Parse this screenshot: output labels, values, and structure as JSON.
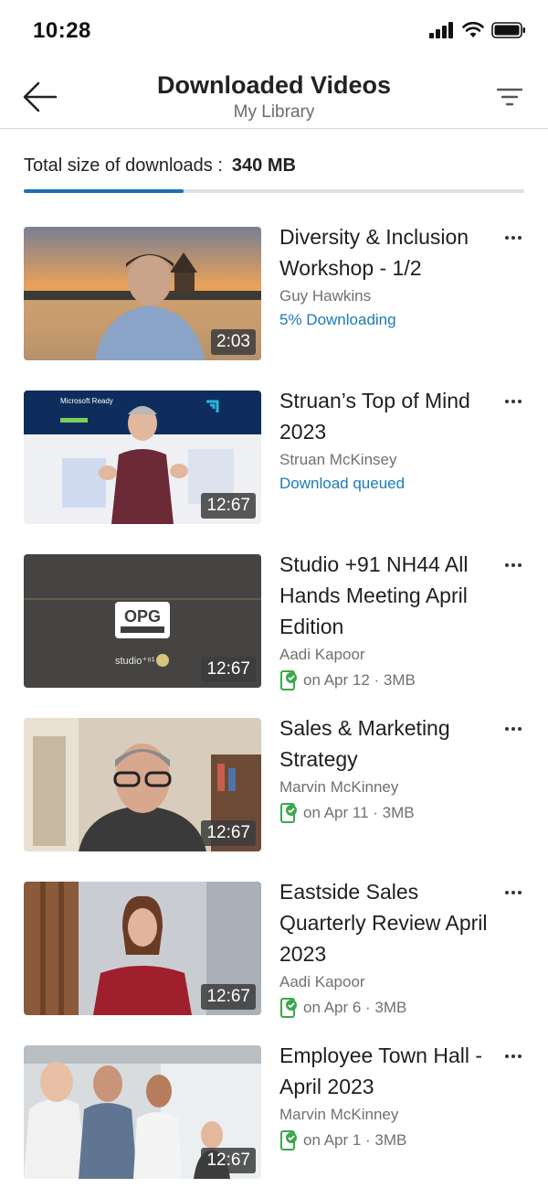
{
  "status_bar": {
    "time": "10:28"
  },
  "header": {
    "title": "Downloaded Videos",
    "subtitle": "My Library"
  },
  "storage": {
    "label": "Total size of downloads :",
    "value": "340 MB",
    "fraction_used": 0.32
  },
  "videos": [
    {
      "title": "Diversity & Inclusion Workshop - 1/2",
      "author": "Guy Hawkins",
      "status": "5% Downloading",
      "duration": "2:03"
    },
    {
      "title": "Struan’s Top of Mind 2023",
      "author": "Struan McKinsey",
      "status": "Download queued",
      "duration": "12:67"
    },
    {
      "title": "Studio +91 NH44 All Hands Meeting April Edition",
      "author": "Aadi Kapoor",
      "status": "on Apr 12 · 3MB",
      "duration": "12:67"
    },
    {
      "title": "Sales & Marketing Strategy",
      "author": "Marvin McKinney",
      "status": "on Apr 11 · 3MB",
      "duration": "12:67"
    },
    {
      "title": "Eastside Sales Quarterly Review April 2023",
      "author": "Aadi Kapoor",
      "status": "on Apr 6 · 3MB",
      "duration": "12:67"
    },
    {
      "title": "Employee Town Hall - April 2023",
      "author": "Marvin McKinney",
      "status": "on Apr 1 · 3MB",
      "duration": "12:67"
    }
  ],
  "thumbnail_text": {
    "ms_ready": "Microsoft Ready",
    "opg": "OPG",
    "studio": "studio⁺⁹¹"
  },
  "colors": {
    "accent": "#1f6fb4",
    "link": "#1b7ab8",
    "download_icon": "#3aa84a"
  }
}
